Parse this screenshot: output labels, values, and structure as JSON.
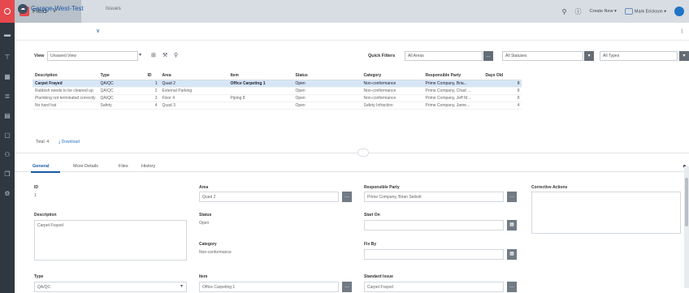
{
  "app": {
    "name": "Field",
    "app_icon": "T",
    "dropdown_icon": "chevron-down-icon"
  },
  "topbar": {
    "create_new": "Create New",
    "user": "Mark Erickson"
  },
  "breadcrumb": {
    "project": "Garage-West-Test",
    "section": "Issues"
  },
  "filters": {
    "view_label": "View",
    "view_value": "Unsaved View",
    "quick_filters_label": "Quick Filters",
    "areas_value": "All Areas",
    "statuses_value": "All Statuses",
    "types_value": "All Types"
  },
  "table": {
    "columns": [
      "Description",
      "Type",
      "ID",
      "Area",
      "Item",
      "Status",
      "Category",
      "Responsible Party",
      "Days Old"
    ],
    "rows": [
      [
        "Carpet Frayed",
        "QA/QC",
        "1",
        "Quad 2",
        "Office Carpeting 1",
        "Open",
        "Non-conformance",
        "Prime Company, Bria...",
        "8"
      ],
      [
        "Rubbish needs to be cleaned up",
        "QA/QC",
        "2",
        "External Parking",
        "",
        "Open",
        "Non-conformance",
        "Prime Company, Chad ...",
        "8"
      ],
      [
        "Plumbing not terminated correctly",
        "QA/QC",
        "3",
        "Floor 4",
        "Piping 8",
        "Open",
        "Non-conformance",
        "Prime Company, Jeff M...",
        "8"
      ],
      [
        "No hard hat",
        "Safety",
        "4",
        "Quad 3",
        "",
        "Open",
        "Safety Infraction",
        "Prime Company, Jame...",
        "4"
      ]
    ],
    "selected_row": 0,
    "total_label": "Total:",
    "total_value": "4",
    "download_label": "Download"
  },
  "tabs": [
    "General",
    "More Details",
    "Files",
    "History"
  ],
  "detail": {
    "id_label": "ID",
    "id_value": "1",
    "description_label": "Description",
    "description_value": "Carpet Frayed",
    "area_label": "Area",
    "area_value": "Quad 2",
    "status_label": "Status",
    "status_value": "Open",
    "category_label": "Category",
    "category_value": "Non-conformance",
    "responsible_label": "Responsible Party",
    "responsible_value": "Prime Company, Brian Seibolt",
    "start_on_label": "Start On",
    "fix_by_label": "Fix By",
    "corrective_label": "Corrective Actions",
    "type_label": "Type",
    "type_value": "QA/QC",
    "item_label": "Item",
    "item_value": "Office Carpeting 1",
    "standard_issue_label": "Standard Issue",
    "standard_issue_value": "Carpet Frayed"
  },
  "colors": {
    "brand_red": "#e5484d",
    "accent_blue": "#1f74c6",
    "nav_dark": "#2f3740",
    "selected_row": "#d6e6f6"
  }
}
